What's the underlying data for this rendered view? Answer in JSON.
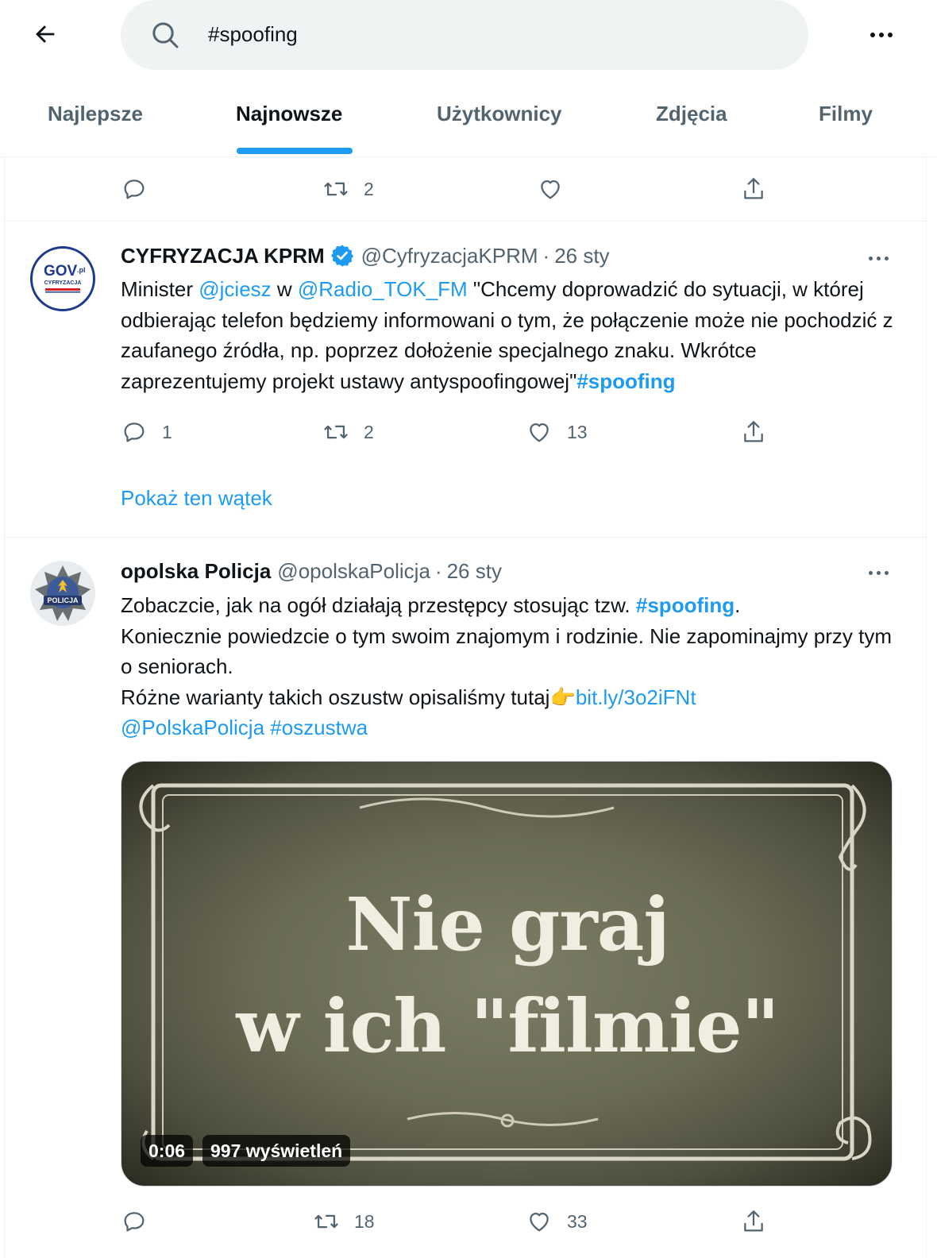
{
  "search": {
    "query": "#spoofing"
  },
  "tabs": [
    {
      "label": "Najlepsze",
      "active": false
    },
    {
      "label": "Najnowsze",
      "active": true
    },
    {
      "label": "Użytkownicy",
      "active": false
    },
    {
      "label": "Zdjęcia",
      "active": false
    },
    {
      "label": "Filmy",
      "active": false
    }
  ],
  "colors": {
    "accent": "#1d9bf0",
    "text": "#0f1419",
    "muted": "#536471",
    "border": "#eff3f4"
  },
  "prev_tweet": {
    "reply_count": "",
    "retweet_count": "2",
    "like_count": "",
    "share": ""
  },
  "tweet1": {
    "author": "CYFRYZACJA KPRM",
    "verified": true,
    "handle": "@CyfryzacjaKPRM",
    "sep": "·",
    "date": "26 sty",
    "avatar_line1": "GOV",
    "avatar_line1_sup": ".pl",
    "avatar_line2": "CYFRYZACJA",
    "text": {
      "t1": "Minister ",
      "m1": "@jciesz",
      "t2": " w ",
      "m2": "@Radio_TOK_FM",
      "t3": " \"Chcemy doprowadzić do sytuacji, w której odbierając telefon będziemy informowani o tym, że połączenie może nie pochodzić z zaufanego źródła, np. poprzez dołożenie specjalnego znaku. Wkrótce zaprezentujemy projekt ustawy antyspoofingowej\"",
      "h1": "#spoofing"
    },
    "reply_count": "1",
    "retweet_count": "2",
    "like_count": "13",
    "show_thread": "Pokaż ten wątek"
  },
  "tweet2": {
    "author": "opolska Policja",
    "handle": "@opolskaPolicja",
    "sep": "·",
    "date": "26 sty",
    "avatar_label": "POLICJA",
    "text": {
      "t1": "Zobaczcie, jak na ogół działają przestępcy stosując tzw. ",
      "h1": "#spoofing",
      "t2": ".",
      "t3": "Koniecznie powiedzcie o tym swoim znajomym i rodzinie. Nie zapominajmy przy tym o seniorach.",
      "t4": "Różne warianty takich oszustw opisaliśmy tutaj",
      "emoji": "👉",
      "l1": "bit.ly/3o2iFNt",
      "m1": "@PolskaPolicja",
      "t5": " ",
      "h2": "#oszustwa"
    },
    "video": {
      "title_line1": "Nie graj",
      "title_line2": "w ich \"filmie\"",
      "duration": "0:06",
      "views": "997 wyświetleń"
    },
    "reply_count": "",
    "retweet_count": "18",
    "like_count": "33"
  }
}
